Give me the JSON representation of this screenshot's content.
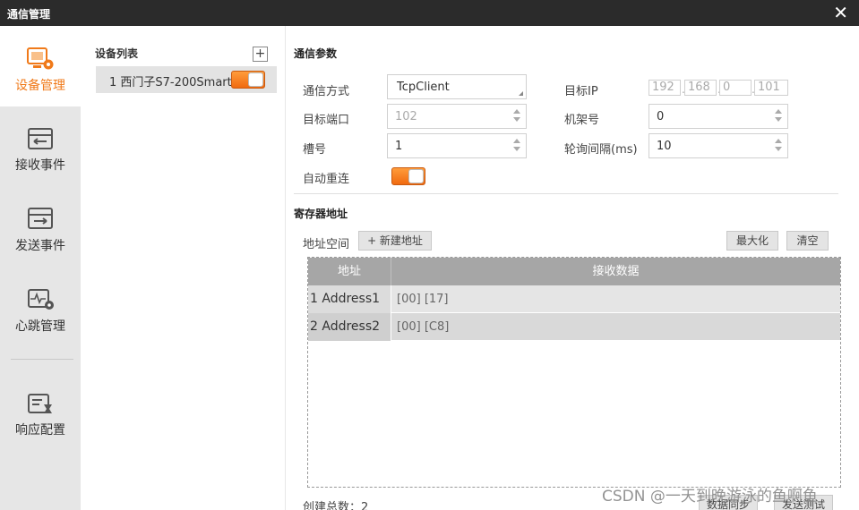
{
  "window": {
    "title": "通信管理",
    "close_glyph": "✕"
  },
  "nav": {
    "items": [
      {
        "label": "设备管理",
        "icon": "device-icon",
        "active": true
      },
      {
        "label": "接收事件",
        "icon": "receive-icon",
        "active": false
      },
      {
        "label": "发送事件",
        "icon": "send-icon",
        "active": false
      },
      {
        "label": "心跳管理",
        "icon": "heartbeat-icon",
        "active": false
      },
      {
        "label": "响应配置",
        "icon": "response-icon",
        "active": false
      }
    ],
    "accent": "#f07a1a"
  },
  "device_list": {
    "title": "设备列表",
    "add_glyph": "+",
    "devices": [
      {
        "label": "1 西门子S7-200Smart",
        "enabled": true
      }
    ]
  },
  "comm": {
    "title": "通信参数",
    "mode_label": "通信方式",
    "mode_value": "TcpClient",
    "target_ip_label": "目标IP",
    "ip": [
      "192",
      "168",
      "0",
      "101"
    ],
    "target_port_label": "目标端口",
    "target_port_value": "102",
    "rack_label": "机架号",
    "rack_value": "0",
    "slot_label": "槽号",
    "slot_value": "1",
    "poll_label": "轮询间隔(ms)",
    "poll_value": "10",
    "reconnect_label": "自动重连",
    "reconnect_on": true
  },
  "register": {
    "title": "寄存器地址",
    "space_label": "地址空间",
    "new_button": "+ 新建地址",
    "maximize_button": "最大化",
    "clear_button": "清空",
    "columns": [
      "地址",
      "接收数据"
    ],
    "rows": [
      {
        "address": "1 Address1",
        "data": "[00] [17]"
      },
      {
        "address": "2 Address2",
        "data": "[00] [C8]"
      }
    ],
    "total_label": "创建总数：2",
    "sync_button": "数据同步",
    "test_button": "发送测试"
  },
  "watermark": "CSDN @一天到晚游泳的鱼啊鱼"
}
